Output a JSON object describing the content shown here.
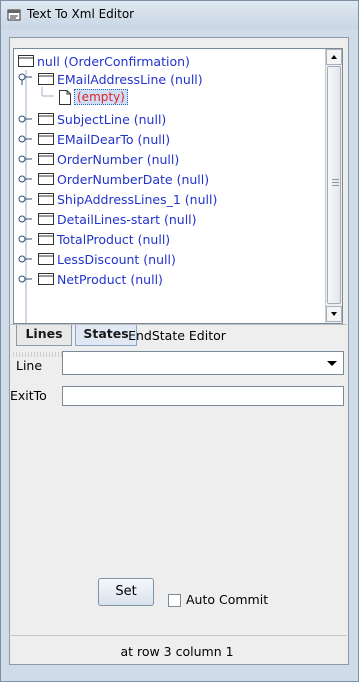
{
  "window": {
    "title": "Text To Xml Editor"
  },
  "tree": {
    "root_label": "null (OrderConfirmation)",
    "nodes": [
      {
        "label": "EMailAddressLine (null)",
        "expanded": true,
        "child": "(empty)"
      },
      {
        "label": "SubjectLine (null)"
      },
      {
        "label": "EMailDearTo (null)"
      },
      {
        "label": "OrderNumber (null)"
      },
      {
        "label": "OrderNumberDate (null)"
      },
      {
        "label": "ShipAddressLines_1 (null)"
      },
      {
        "label": "DetailLines-start (null)"
      },
      {
        "label": "TotalProduct (null)"
      },
      {
        "label": "LessDiscount (null)"
      },
      {
        "label": "NetProduct (null)"
      }
    ]
  },
  "tabs": [
    {
      "label": "Lines",
      "selected": false
    },
    {
      "label": "States",
      "selected": true
    }
  ],
  "editor": {
    "title": "EndState Editor",
    "line_label": "Line",
    "line_value": "",
    "exitto_label": "ExitTo",
    "exitto_value": "",
    "set_label": "Set",
    "auto_commit_label": "Auto Commit",
    "auto_commit_checked": false
  },
  "status": {
    "text": "at row 3 column 1"
  },
  "colors": {
    "node_text": "#2233cc",
    "empty_text": "#e0202a",
    "accent": "#cfe0f6"
  },
  "icons": {
    "title": "editor-window-icon",
    "node": "folder-icon",
    "leaf": "document-icon",
    "combo": "chevron-down-icon"
  }
}
